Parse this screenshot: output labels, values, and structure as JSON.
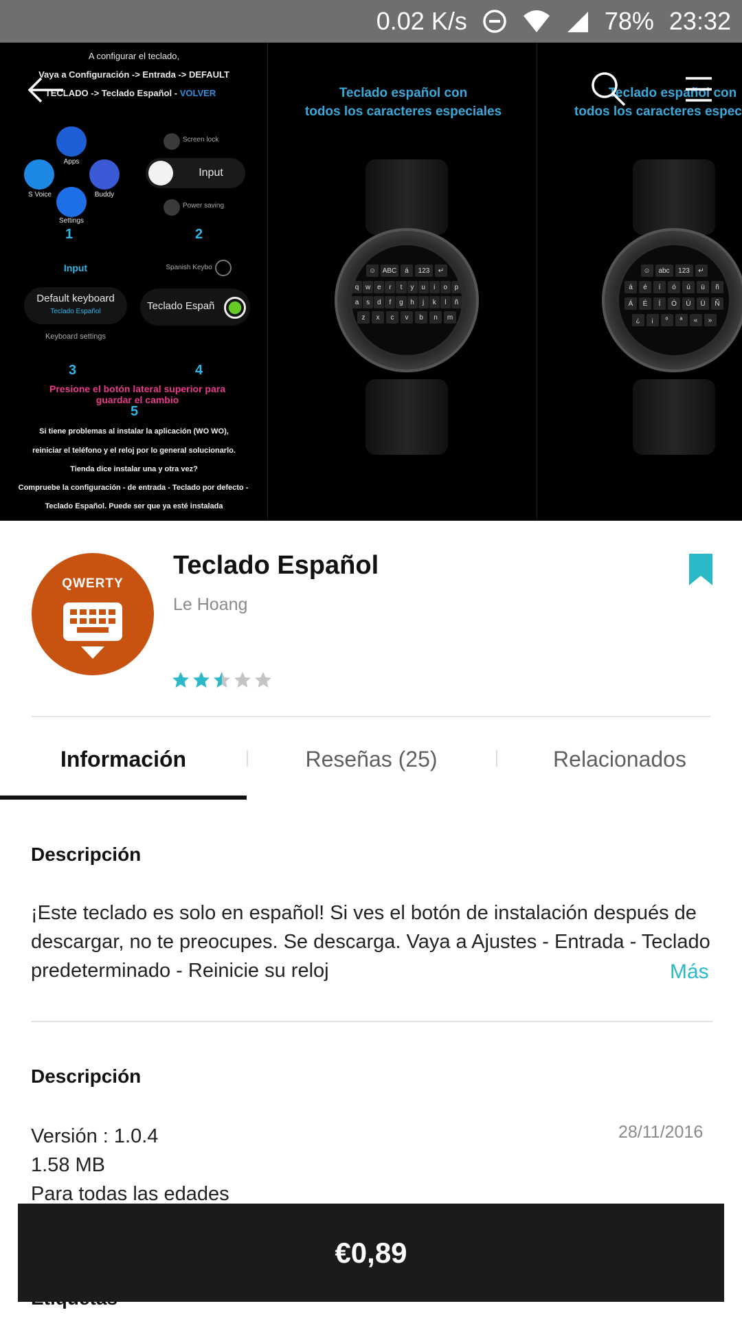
{
  "status_bar": {
    "network_speed": "0.02 K/s",
    "battery": "78%",
    "time": "23:32"
  },
  "gallery": {
    "shot1": {
      "line1": "A configurar el teclado,",
      "line2": "Vaya a Configuración -> Entrada -> DEFAULT",
      "line3": "TECLADO -> Teclado Español -",
      "line3_highlight": "VOLVER",
      "apps_label": "Apps",
      "svoice_label": "S Voice",
      "buddy_label": "Buddy",
      "settings_label": "Settings",
      "screen_lock": "Screen lock",
      "input_label_pill": "Input",
      "power_saving": "Power saving",
      "step1": "1",
      "step2": "2",
      "input_label": "Input",
      "spanish_keyboard": "Spanish Keybo",
      "default_keyboard": "Default keyboard",
      "teclado_espanol_small": "Teclado Español",
      "teclado_espanol_pill": "Teclado Españ",
      "keyboard_settings": "Keyboard settings",
      "step3": "3",
      "step4": "4",
      "pink_text": "Presione el botón lateral superior para guardar el cambio",
      "step5": "5",
      "info1": "Si tiene problemas al instalar la aplicación (WO WO),",
      "info2": "reiniciar el teléfono y el reloj por lo general solucionarlo.",
      "info3": "Tienda dice instalar una y otra vez?",
      "info4": "Compruebe la configuración - de entrada - Teclado por defecto -",
      "info5": "Teclado Español. Puede ser que ya esté instalada"
    },
    "shot2": {
      "title_line1": "Teclado español con",
      "title_line2": "todos los caracteres especiales",
      "keys_row0": [
        "☺",
        "ABC",
        "á",
        "123",
        "↵"
      ],
      "keys_row1": [
        "q",
        "w",
        "e",
        "r",
        "t",
        "y",
        "u",
        "i",
        "o",
        "p"
      ],
      "keys_row2": [
        "a",
        "s",
        "d",
        "f",
        "g",
        "h",
        "j",
        "k",
        "l",
        "ñ"
      ],
      "keys_row3": [
        "z",
        "x",
        "c",
        "v",
        "b",
        "n",
        "m"
      ]
    },
    "shot3": {
      "title_line1": "Teclado español con",
      "title_line2": "todos los caracteres especiales",
      "keys_row0": [
        "☺",
        "abc",
        "123",
        "↵"
      ],
      "keys_row1": [
        "á",
        "é",
        "í",
        "ó",
        "ú",
        "ü",
        "ñ"
      ],
      "keys_row2": [
        "Á",
        "É",
        "Í",
        "Ó",
        "Ú",
        "Ü",
        "Ñ"
      ],
      "keys_row3": [
        "¿",
        "¡",
        "º",
        "ª",
        "«",
        "»"
      ]
    }
  },
  "app": {
    "icon_text": "QWERTY",
    "title": "Teclado Español",
    "developer": "Le Hoang",
    "rating": 2.5,
    "rating_max": 5
  },
  "tabs": [
    {
      "label": "Información",
      "active": true
    },
    {
      "label": "Reseñas (25)",
      "active": false
    },
    {
      "label": "Relacionados",
      "active": false
    }
  ],
  "description": {
    "title": "Descripción",
    "text": "¡Este teclado es solo en español! Si ves el botón de instalación después de descargar, no te preocupes. Se descarga. Vaya a Ajustes - Entrada - Teclado predeterminado - Reinicie su reloj",
    "more": "Más"
  },
  "details": {
    "title": "Descripción",
    "version": "Versión : 1.0.4",
    "size": "1.58 MB",
    "age": "Para todas las edades",
    "date": "28/11/2016"
  },
  "tags": {
    "title": "Etiquetas"
  },
  "buy": {
    "price": "€0,89"
  },
  "colors": {
    "accent": "#2bb8c7",
    "app_icon_bg": "#c8520f",
    "buy_bar": "#1b1b1b"
  }
}
